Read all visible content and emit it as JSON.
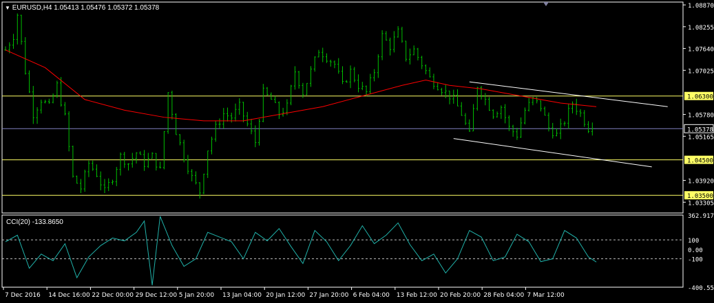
{
  "header": {
    "symbol": "EURUSD,H4",
    "ohlc": "1.05413 1.05476 1.05372 1.05378",
    "menu_icon": "triangle-down-icon"
  },
  "indicator": {
    "label": "CCI(20) -133.8650",
    "axis_labels": [
      "362.9172",
      "100",
      "0.00",
      "-100",
      "-400.5553"
    ]
  },
  "colors": {
    "background": "#000000",
    "candle": "#00c000",
    "moving_average": "#ff0000",
    "cci_line": "#20b2aa",
    "horizontal_line": "#ffff66",
    "current_price_line": "#8080c0",
    "trend_line": "#ffffff",
    "axis": "#ffffff"
  },
  "price_axis": {
    "labels": [
      "1.08870",
      "1.08255",
      "1.07640",
      "1.07025",
      "1.05780",
      "1.05165",
      "1.03920",
      "1.03305"
    ],
    "highlighted": [
      "1.06300",
      "1.04500",
      "1.03500"
    ],
    "current": "1.05378"
  },
  "time_axis": [
    "7 Dec 2016",
    "14 Dec 16:00",
    "22 Dec 00:00",
    "29 Dec 12:00",
    "5 Jan 20:00",
    "13 Jan 04:00",
    "20 Jan 12:00",
    "27 Jan 20:00",
    "6 Feb 04:00",
    "13 Feb 12:00",
    "20 Feb 20:00",
    "28 Feb 04:00",
    "7 Mar 12:00"
  ],
  "chart_data": {
    "type": "line",
    "title": "EURUSD,H4",
    "price_range": [
      1.03,
      1.0895
    ],
    "horizontal_levels": [
      1.063,
      1.045,
      1.035
    ],
    "current_price": 1.05378,
    "close_path": [
      [
        0,
        1.076
      ],
      [
        2,
        1.08
      ],
      [
        3,
        1.086
      ],
      [
        5,
        1.07
      ],
      [
        7,
        1.058
      ],
      [
        9,
        1.062
      ],
      [
        11,
        1.06
      ],
      [
        13,
        1.066
      ],
      [
        15,
        1.057
      ],
      [
        17,
        1.04
      ],
      [
        19,
        1.037
      ],
      [
        21,
        1.044
      ],
      [
        23,
        1.041
      ],
      [
        25,
        1.036
      ],
      [
        27,
        1.04
      ],
      [
        29,
        1.046
      ],
      [
        31,
        1.044
      ],
      [
        33,
        1.047
      ],
      [
        35,
        1.044
      ],
      [
        37,
        1.046
      ],
      [
        39,
        1.042
      ],
      [
        41,
        1.064
      ],
      [
        43,
        1.053
      ],
      [
        45,
        1.046
      ],
      [
        47,
        1.04
      ],
      [
        49,
        1.036
      ],
      [
        51,
        1.048
      ],
      [
        53,
        1.054
      ],
      [
        55,
        1.058
      ],
      [
        57,
        1.057
      ],
      [
        59,
        1.06
      ],
      [
        61,
        1.055
      ],
      [
        63,
        1.05
      ],
      [
        65,
        1.064
      ],
      [
        67,
        1.062
      ],
      [
        69,
        1.058
      ],
      [
        71,
        1.06
      ],
      [
        73,
        1.07
      ],
      [
        75,
        1.064
      ],
      [
        77,
        1.07
      ],
      [
        79,
        1.076
      ],
      [
        81,
        1.074
      ],
      [
        83,
        1.072
      ],
      [
        85,
        1.066
      ],
      [
        87,
        1.07
      ],
      [
        89,
        1.066
      ],
      [
        91,
        1.064
      ],
      [
        93,
        1.07
      ],
      [
        95,
        1.08
      ],
      [
        97,
        1.077
      ],
      [
        99,
        1.081
      ],
      [
        101,
        1.074
      ],
      [
        103,
        1.076
      ],
      [
        105,
        1.072
      ],
      [
        107,
        1.068
      ],
      [
        109,
        1.066
      ],
      [
        111,
        1.064
      ],
      [
        113,
        1.062
      ],
      [
        115,
        1.058
      ],
      [
        117,
        1.052
      ],
      [
        119,
        1.066
      ],
      [
        121,
        1.062
      ],
      [
        123,
        1.058
      ],
      [
        125,
        1.06
      ],
      [
        127,
        1.054
      ],
      [
        129,
        1.052
      ],
      [
        131,
        1.059
      ],
      [
        133,
        1.062
      ],
      [
        135,
        1.06
      ],
      [
        137,
        1.054
      ],
      [
        139,
        1.052
      ],
      [
        141,
        1.056
      ],
      [
        143,
        1.061
      ],
      [
        145,
        1.058
      ],
      [
        147,
        1.054
      ],
      [
        149,
        1.056
      ]
    ],
    "moving_average": [
      [
        0,
        1.076
      ],
      [
        10,
        1.071
      ],
      [
        20,
        1.062
      ],
      [
        30,
        1.059
      ],
      [
        40,
        1.057
      ],
      [
        50,
        1.056
      ],
      [
        60,
        1.056
      ],
      [
        70,
        1.058
      ],
      [
        80,
        1.06
      ],
      [
        90,
        1.063
      ],
      [
        100,
        1.066
      ],
      [
        106,
        1.0675
      ],
      [
        112,
        1.066
      ],
      [
        120,
        1.065
      ],
      [
        130,
        1.063
      ],
      [
        140,
        1.061
      ],
      [
        149,
        1.06
      ]
    ],
    "channel_upper": [
      [
        117,
        1.067
      ],
      [
        167,
        1.06
      ]
    ],
    "channel_lower": [
      [
        113,
        1.051
      ],
      [
        163,
        1.043
      ]
    ],
    "cci": {
      "range": [
        -400.5553,
        362.9172
      ],
      "levels": [
        100,
        0,
        -100
      ],
      "values": [
        [
          0,
          80
        ],
        [
          3,
          150
        ],
        [
          6,
          -200
        ],
        [
          9,
          -50
        ],
        [
          12,
          -120
        ],
        [
          15,
          60
        ],
        [
          18,
          -300
        ],
        [
          21,
          -80
        ],
        [
          24,
          40
        ],
        [
          27,
          120
        ],
        [
          30,
          90
        ],
        [
          33,
          180
        ],
        [
          35,
          300
        ],
        [
          37,
          -380
        ],
        [
          39,
          350
        ],
        [
          42,
          40
        ],
        [
          45,
          -180
        ],
        [
          48,
          -100
        ],
        [
          51,
          180
        ],
        [
          54,
          130
        ],
        [
          57,
          80
        ],
        [
          60,
          -100
        ],
        [
          63,
          180
        ],
        [
          66,
          90
        ],
        [
          69,
          220
        ],
        [
          72,
          30
        ],
        [
          75,
          -150
        ],
        [
          78,
          200
        ],
        [
          81,
          80
        ],
        [
          84,
          -120
        ],
        [
          87,
          40
        ],
        [
          90,
          250
        ],
        [
          93,
          60
        ],
        [
          96,
          150
        ],
        [
          99,
          280
        ],
        [
          102,
          50
        ],
        [
          105,
          -120
        ],
        [
          108,
          -50
        ],
        [
          111,
          -250
        ],
        [
          114,
          -100
        ],
        [
          117,
          200
        ],
        [
          120,
          130
        ],
        [
          123,
          -120
        ],
        [
          126,
          -80
        ],
        [
          129,
          160
        ],
        [
          132,
          80
        ],
        [
          135,
          -130
        ],
        [
          138,
          -100
        ],
        [
          141,
          200
        ],
        [
          144,
          120
        ],
        [
          147,
          -80
        ],
        [
          149,
          -133.865
        ]
      ]
    }
  }
}
